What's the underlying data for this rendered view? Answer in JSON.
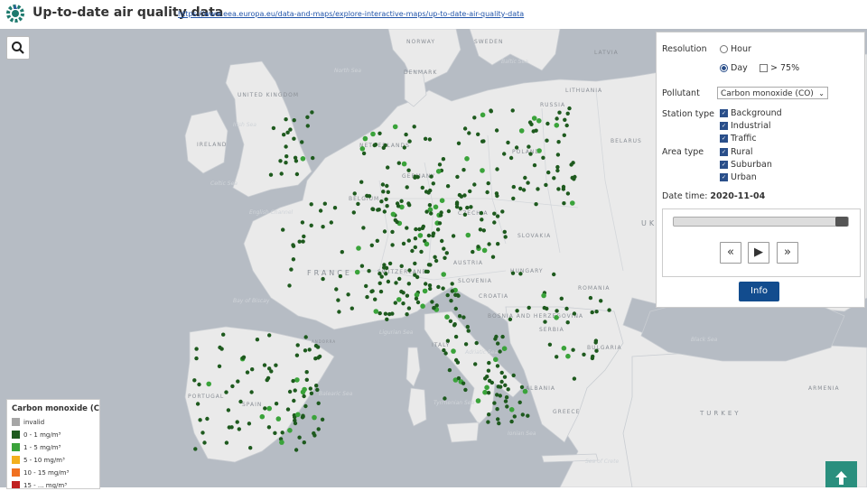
{
  "header": {
    "title": "Up-to-date air quality data",
    "url": "https://www.eea.europa.eu/data-and-maps/explore-interactive-maps/up-to-date-air-quality-data"
  },
  "panel": {
    "resolution_label": "Resolution",
    "resolution_options": [
      "Hour",
      "Day"
    ],
    "resolution_selected": "Day",
    "threshold_label": "> 75%",
    "pollutant_label": "Pollutant",
    "pollutant_value": "Carbon monoxide (CO)",
    "station_type_label": "Station type",
    "station_types": [
      "Background",
      "Industrial",
      "Traffic"
    ],
    "area_type_label": "Area type",
    "area_types": [
      "Rural",
      "Suburban",
      "Urban"
    ],
    "date_label": "Date time:",
    "date_value": "2020-11-04",
    "slider_position": 1.0,
    "buttons": {
      "prev": "«",
      "play": "▶",
      "next": "»"
    },
    "info_label": "Info"
  },
  "legend": {
    "title": "Carbon monoxide (CO)",
    "items": [
      {
        "label": "invalid",
        "color": "#a6a6a6"
      },
      {
        "label": "0 - 1 mg/m³",
        "color": "#1e5a1e"
      },
      {
        "label": "1 - 5 mg/m³",
        "color": "#3aa33a"
      },
      {
        "label": "5 - 10 mg/m³",
        "color": "#f2b01e"
      },
      {
        "label": "10 - 15 mg/m³",
        "color": "#f07020"
      },
      {
        "label": "15 - ... mg/m³",
        "color": "#c02020"
      }
    ]
  },
  "map_labels": {
    "countries": [
      "NORWAY",
      "SWEDEN",
      "DENMARK",
      "UNITED KINGDOM",
      "IRELAND",
      "NETHERLANDS",
      "GERMANY",
      "POLAND",
      "BELGIUM",
      "CZECHIA",
      "SLOVAKIA",
      "FRANCE",
      "SWITZERLAND",
      "AUSTRIA",
      "SLOVENIA",
      "HUNGARY",
      "ROMANIA",
      "CROATIA",
      "BOSNIA AND HERZEGOVINA",
      "SERBIA",
      "BULGARIA",
      "ITALY",
      "SPAIN",
      "PORTUGAL",
      "ALBANIA",
      "GREECE",
      "TURKEY",
      "ARMENIA",
      "LATVIA",
      "LITHUANIA",
      "RUSSIA",
      "BELARUS",
      "UK",
      "ANDORRA"
    ],
    "seas": [
      "North Sea",
      "Baltic Sea",
      "Irish Sea",
      "Celtic Sea",
      "English Channel",
      "Bay of Biscay",
      "Ligurian Sea",
      "Tyrrhenian Sea",
      "Adriatic Sea",
      "Ionian Sea",
      "Black Sea",
      "Sea of Crete",
      "Balearic Sea"
    ]
  },
  "colors": {
    "land": "#eaeaea",
    "water": "#b6bcc4",
    "accent": "#124c8e",
    "dark_green": "#1e5a1e",
    "light_green": "#3aa33a",
    "teal": "#2a8f7e"
  },
  "icons": {
    "logo": "eea-logo",
    "search": "search-icon",
    "scroll_top": "arrow-up-icon"
  }
}
